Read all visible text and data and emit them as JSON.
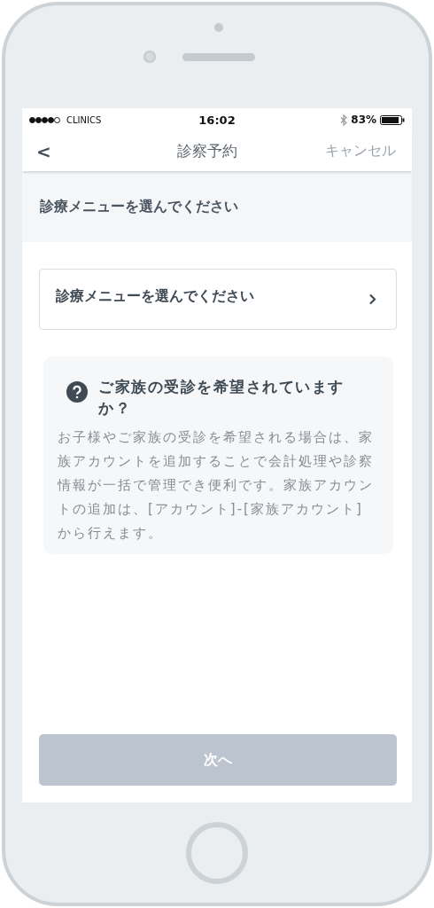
{
  "status_bar": {
    "carrier": "CLINICS",
    "time": "16:02",
    "battery": "83%"
  },
  "nav_bar": {
    "back": "<",
    "title": "診察予約",
    "cancel": "キャンセル"
  },
  "section_header": "診療メニューを選んでください",
  "menu_select": {
    "label": "診療メニューを選んでください"
  },
  "info_box": {
    "title": "ご家族の受診を希望されていますか？",
    "body": "お子様やご家族の受診を希望される場合は、家族アカウントを追加することで会計処理や診察情報が一括で管理でき便利です。家族アカウントの追加は、[アカウント]-[家族アカウント] から行えます。"
  },
  "next_button": {
    "label": "次へ",
    "disabled": true
  }
}
